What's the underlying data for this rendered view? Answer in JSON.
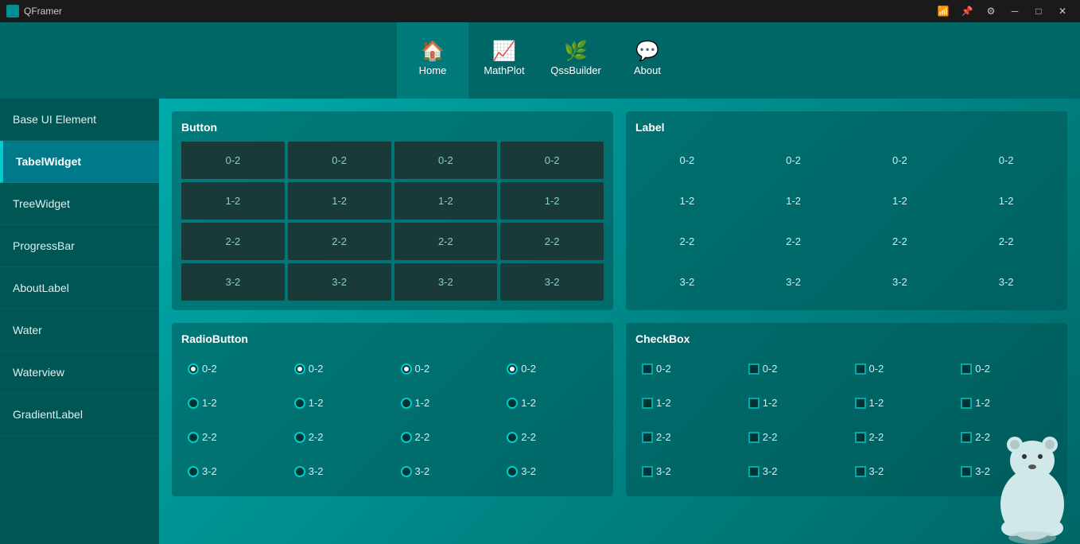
{
  "titlebar": {
    "title": "QFramer",
    "controls": {
      "minimize": "─",
      "maximize": "□",
      "close": "✕"
    },
    "system_icons": [
      "⊞",
      "📌",
      "🔲"
    ]
  },
  "toolbar": {
    "items": [
      {
        "id": "home",
        "label": "Home",
        "icon": "🏠",
        "active": true
      },
      {
        "id": "mathplot",
        "label": "MathPlot",
        "icon": "📈",
        "active": false
      },
      {
        "id": "qssbuilder",
        "label": "QssBuilder",
        "icon": "🌿",
        "active": false
      },
      {
        "id": "about",
        "label": "About",
        "icon": "💬",
        "active": false
      }
    ]
  },
  "sidebar": {
    "items": [
      {
        "id": "base-ui",
        "label": "Base UI Element",
        "active": false
      },
      {
        "id": "tabelwidget",
        "label": "TabelWidget",
        "active": true
      },
      {
        "id": "treewidget",
        "label": "TreeWidget",
        "active": false
      },
      {
        "id": "progressbar",
        "label": "ProgressBar",
        "active": false
      },
      {
        "id": "aboutlabel",
        "label": "AboutLabel",
        "active": false
      },
      {
        "id": "water",
        "label": "Water",
        "active": false
      },
      {
        "id": "waterview",
        "label": "Waterview",
        "active": false
      },
      {
        "id": "gradientlabel",
        "label": "GradientLabel",
        "active": false
      }
    ]
  },
  "content": {
    "button_section": {
      "title": "Button",
      "rows": [
        [
          "0-2",
          "0-2",
          "0-2",
          "0-2"
        ],
        [
          "1-2",
          "1-2",
          "1-2",
          "1-2"
        ],
        [
          "2-2",
          "2-2",
          "2-2",
          "2-2"
        ],
        [
          "3-2",
          "3-2",
          "3-2",
          "3-2"
        ]
      ]
    },
    "label_section": {
      "title": "Label",
      "rows": [
        [
          "0-2",
          "0-2",
          "0-2",
          "0-2"
        ],
        [
          "1-2",
          "1-2",
          "1-2",
          "1-2"
        ],
        [
          "2-2",
          "2-2",
          "2-2",
          "2-2"
        ],
        [
          "3-2",
          "3-2",
          "3-2",
          "3-2"
        ]
      ]
    },
    "radiobutton_section": {
      "title": "RadioButton",
      "rows": [
        [
          "0-2",
          "0-2",
          "0-2",
          "0-2"
        ],
        [
          "1-2",
          "1-2",
          "1-2",
          "1-2"
        ],
        [
          "2-2",
          "2-2",
          "2-2",
          "2-2"
        ],
        [
          "3-2",
          "3-2",
          "3-2",
          "3-2"
        ]
      ]
    },
    "checkbox_section": {
      "title": "CheckBox",
      "rows": [
        [
          "0-2",
          "0-2",
          "0-2",
          "0-2"
        ],
        [
          "1-2",
          "1-2",
          "1-2",
          "1-2"
        ],
        [
          "2-2",
          "2-2",
          "2-2",
          "2-2"
        ],
        [
          "3-2",
          "3-2",
          "3-2",
          "3-2"
        ]
      ]
    }
  }
}
